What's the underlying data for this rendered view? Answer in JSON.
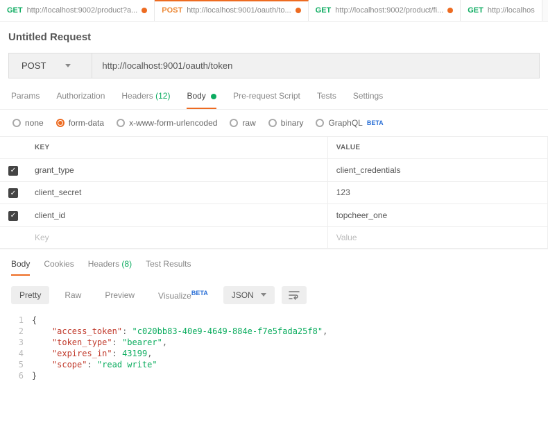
{
  "tabs": [
    {
      "method": "GET",
      "methodClass": "get",
      "url": "http://localhost:9002/product?a...",
      "dot": true,
      "active": false
    },
    {
      "method": "POST",
      "methodClass": "post",
      "url": "http://localhost:9001/oauth/to...",
      "dot": true,
      "active": true
    },
    {
      "method": "GET",
      "methodClass": "get",
      "url": "http://localhost:9002/product/fi...",
      "dot": true,
      "active": false
    },
    {
      "method": "GET",
      "methodClass": "get",
      "url": "http://localhos",
      "dot": false,
      "active": false
    }
  ],
  "request_title": "Untitled Request",
  "method": "POST",
  "url": "http://localhost:9001/oauth/token",
  "request_subtabs": [
    {
      "label": "Params",
      "active": false
    },
    {
      "label": "Authorization",
      "active": false
    },
    {
      "label": "Headers",
      "count": "(12)",
      "active": false
    },
    {
      "label": "Body",
      "dot": true,
      "active": true
    },
    {
      "label": "Pre-request Script",
      "active": false
    },
    {
      "label": "Tests",
      "active": false
    },
    {
      "label": "Settings",
      "active": false
    }
  ],
  "body_types": {
    "none": "none",
    "form_data": "form-data",
    "url_encoded": "x-www-form-urlencoded",
    "raw": "raw",
    "binary": "binary",
    "graphql": "GraphQL",
    "beta": "BETA"
  },
  "table_headers": {
    "key": "KEY",
    "value": "VALUE"
  },
  "form_rows": [
    {
      "checked": true,
      "key": "grant_type",
      "value": "client_credentials"
    },
    {
      "checked": true,
      "key": "client_secret",
      "value": "123"
    },
    {
      "checked": true,
      "key": "client_id",
      "value": "topcheer_one"
    }
  ],
  "table_placeholders": {
    "key": "Key",
    "value": "Value"
  },
  "response_tabs": [
    {
      "label": "Body",
      "active": true
    },
    {
      "label": "Cookies",
      "active": false
    },
    {
      "label": "Headers",
      "count": "(8)",
      "active": false
    },
    {
      "label": "Test Results",
      "active": false
    }
  ],
  "response_views": {
    "pretty": "Pretty",
    "raw": "Raw",
    "preview": "Preview",
    "visualize": "Visualize",
    "beta": "BETA"
  },
  "response_type": "JSON",
  "json_lines": {
    "l1": "{",
    "l2_k": "\"access_token\"",
    "l2_v": "\"c020bb83-40e9-4649-884e-f7e5fada25f8\"",
    "l3_k": "\"token_type\"",
    "l3_v": "\"bearer\"",
    "l4_k": "\"expires_in\"",
    "l4_v": "43199",
    "l5_k": "\"scope\"",
    "l5_v": "\"read write\"",
    "l6": "}"
  },
  "gutter": [
    "1",
    "2",
    "3",
    "4",
    "5",
    "6"
  ]
}
